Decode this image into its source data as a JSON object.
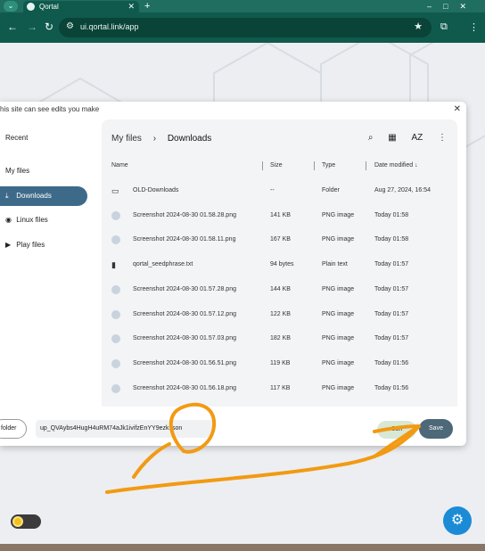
{
  "browser": {
    "tab_title": "Qortal",
    "tab_close": "✕",
    "new_tab": "+",
    "url": "ui.qortal.link/app",
    "window_buttons": "–□✕"
  },
  "dialog": {
    "notice": "his site can see edits you make",
    "close": "✕",
    "sidebar": [
      {
        "label": "Recent"
      },
      {
        "label": "My files"
      },
      {
        "label": "Downloads"
      },
      {
        "label": "Linux files"
      },
      {
        "label": "Play files"
      }
    ],
    "breadcrumb": {
      "root": "My files",
      "sep": "›",
      "current": "Downloads"
    },
    "sort_label": "AZ",
    "columns": {
      "name": "Name",
      "size": "Size",
      "type": "Type",
      "date": "Date modified ↓"
    },
    "rows": [
      {
        "name": "OLD-Downloads",
        "size": "--",
        "type": "Folder",
        "date": "Aug 27, 2024, 16:54",
        "icon": "folder"
      },
      {
        "name": "Screenshot 2024-08-30 01.58.28.png",
        "size": "141 KB",
        "type": "PNG image",
        "date": "Today 01:58",
        "icon": "image"
      },
      {
        "name": "Screenshot 2024-08-30 01.58.11.png",
        "size": "167 KB",
        "type": "PNG image",
        "date": "Today 01:58",
        "icon": "image"
      },
      {
        "name": "qortal_seedphrase.txt",
        "size": "94 bytes",
        "type": "Plain text",
        "date": "Today 01:57",
        "icon": "text"
      },
      {
        "name": "Screenshot 2024-08-30 01.57.28.png",
        "size": "144 KB",
        "type": "PNG image",
        "date": "Today 01:57",
        "icon": "image"
      },
      {
        "name": "Screenshot 2024-08-30 01.57.12.png",
        "size": "122 KB",
        "type": "PNG image",
        "date": "Today 01:57",
        "icon": "image"
      },
      {
        "name": "Screenshot 2024-08-30 01.57.03.png",
        "size": "182 KB",
        "type": "PNG image",
        "date": "Today 01:57",
        "icon": "image"
      },
      {
        "name": "Screenshot 2024-08-30 01.56.51.png",
        "size": "119 KB",
        "type": "PNG image",
        "date": "Today 01:56",
        "icon": "image"
      },
      {
        "name": "Screenshot 2024-08-30 01.56.18.png",
        "size": "117 KB",
        "type": "PNG image",
        "date": "Today 01:56",
        "icon": "image"
      }
    ],
    "new_folder_label": "folder",
    "filename_value": "up_QVAybs4HugH4uRM74aJk1ivifzEnYY9ezk.json",
    "cancel_label": "Can",
    "save_label": "Save"
  },
  "colors": {
    "toolbar": "#0f5a4c",
    "active_item": "#3e6a8a",
    "save": "#4d6878",
    "fab": "#1c8bd6",
    "annotation": "#f29a12"
  },
  "icons": {
    "back": "arrow-left-icon",
    "forward": "arrow-right-icon",
    "reload": "reload-icon",
    "search": "search-icon",
    "grid": "grid-view-icon",
    "more": "more-vert-icon",
    "gear": "gear-icon"
  }
}
